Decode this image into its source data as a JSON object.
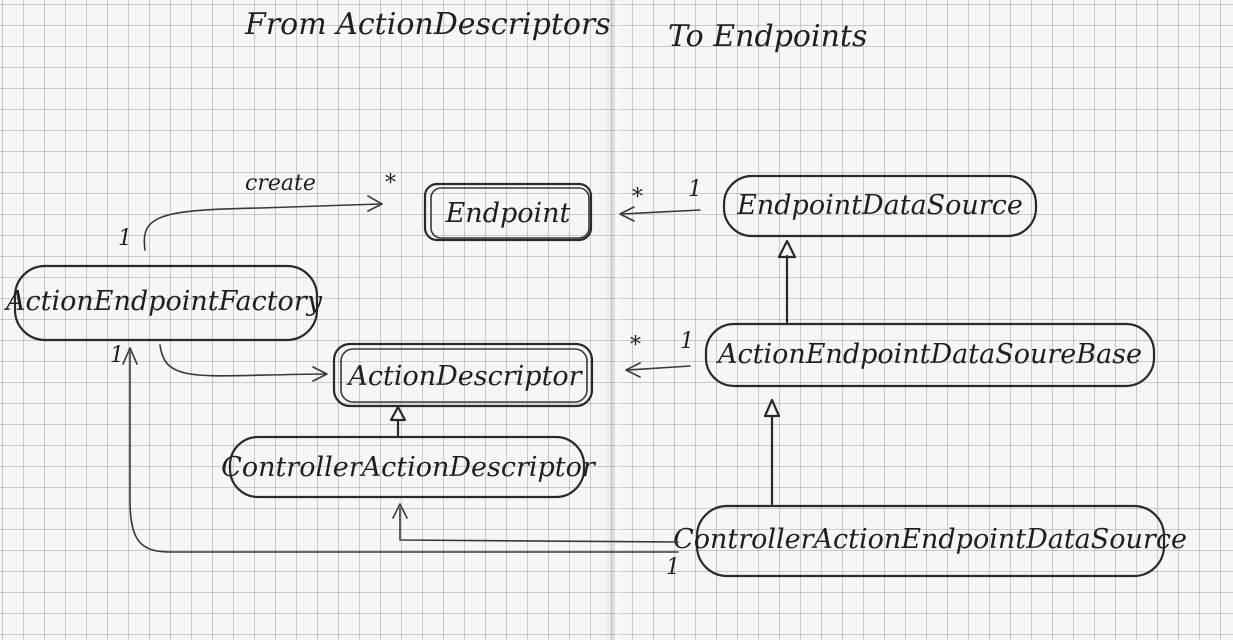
{
  "title": {
    "left": "From ActionDescriptors",
    "right": "To Endpoints"
  },
  "nodes": {
    "endpoint": "Endpoint",
    "endpoint_data_source": "EndpointDataSource",
    "action_endpoint_factory": "ActionEndpointFactory",
    "action_descriptor": "ActionDescriptor",
    "action_endpoint_data_source_base": "ActionEndpointDataSoureBase",
    "controller_action_descriptor": "ControllerActionDescriptor",
    "controller_action_endpoint_data_source": "ControllerActionEndpointDataSource"
  },
  "edges": {
    "create_label": "create",
    "factory_to_endpoint_source": "1",
    "factory_to_endpoint_target": "*",
    "eds_to_endpoint_source": "1",
    "eds_to_endpoint_target": "*",
    "base_to_descriptor_source": "1",
    "base_to_descriptor_target": "*",
    "factory_from_source_target": "1",
    "controller_source_mult": "1"
  }
}
